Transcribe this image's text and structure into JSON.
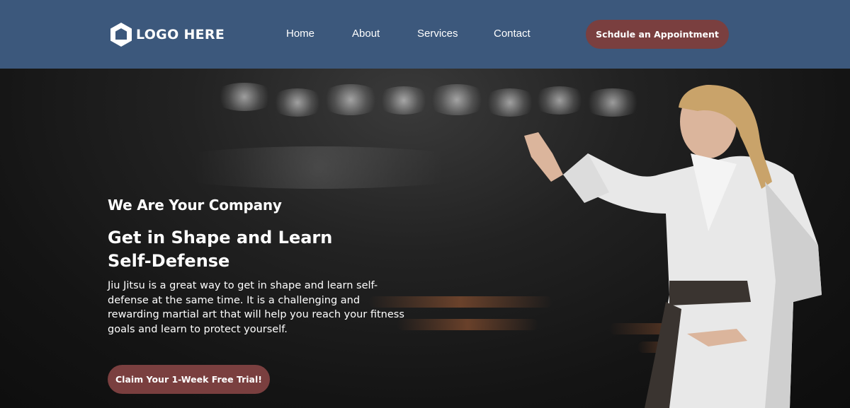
{
  "header": {
    "logo_text": "LOGO HERE",
    "nav": [
      {
        "label": "Home"
      },
      {
        "label": "About"
      },
      {
        "label": "Services"
      },
      {
        "label": "Contact"
      }
    ],
    "cta_label": "Schdule an Appointment"
  },
  "hero": {
    "eyebrow": "We Are Your Company",
    "headline": "Get in Shape and Learn Self-Defense",
    "description": "Jiu Jitsu is a great way to get in shape and learn self-defense at the same time. It is a challenging and rewarding martial art that will help you reach your fitness goals and learn to protect yourself.",
    "cta_label": "Claim Your 1-Week Free Trial!"
  },
  "colors": {
    "header_bg": "#3c587c",
    "accent_button": "#7a3f3f",
    "hero_bg": "#141414",
    "text": "#ffffff"
  }
}
